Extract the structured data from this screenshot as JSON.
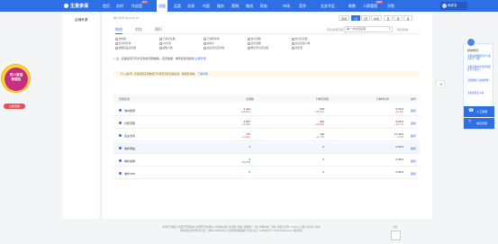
{
  "app": {
    "logo_text": "生意参谋",
    "user_label": "商家名"
  },
  "nav": {
    "items": [
      "首页",
      "实时",
      "作战室",
      "流量",
      "品类",
      "交易",
      "内容",
      "服务",
      "营销",
      "物流",
      "财务",
      "市场",
      "竞争",
      "业务专区",
      "取数",
      "人群管理",
      "学院"
    ],
    "active": "流量",
    "hot": {
      "作战室": "HOT",
      "人群管理": "NEW"
    }
  },
  "sidebar": {
    "items": [
      "店铺来源"
    ]
  },
  "main": {
    "update_time": "统计时间 2019-11-10",
    "range_buttons": [
      "实时",
      "1天",
      "7天",
      "30天",
      "日",
      "周",
      "月"
    ],
    "selected_range": "1天",
    "tabs": [
      "构成",
      "对比",
      "同行"
    ],
    "active_tab": "构成",
    "channel_label": "转化效果归属于：",
    "channel_select": "每一次访问来源",
    "hint_right": "所有终端",
    "checkboxes": [
      "访客数",
      "下单买家数",
      "下单转化率",
      "支付金额",
      "支付买家数",
      "支付转化率",
      "UV价值",
      "客单价",
      "新访客数",
      "关注店铺人数",
      "收藏商品买家数",
      "加购人数",
      "直接支付买家数",
      "粉丝支付买家数",
      "浏览量"
    ],
    "notice": {
      "text": "注：店铺来源已同步至新版流量看板，完善数据，推荐您使用新版",
      "link": "立即升级"
    },
    "warn": {
      "text": "【小二推荐】店铺流量来源数据已升级至完整链路追踪，数据更准确。",
      "link": "了解详情"
    },
    "table": {
      "headers": [
        "流量来源",
        "访客数",
        "下单买家数",
        "下单转化率",
        "操作"
      ],
      "rows": [
        {
          "name": "淘内免费",
          "v1": "3,422",
          "c1": "+125.56%",
          "c1dir": "up",
          "v2": "208",
          "c2": "+150.18%",
          "c2dir": "up",
          "v3": "6.07%",
          "c3": "+12.40%",
          "c3dir": "up",
          "op": "趋势"
        },
        {
          "name": "付费流量",
          "v1": "2,567",
          "c1": "+72.90%",
          "c1dir": "up",
          "v2": "200",
          "c2": "+132.88%",
          "c2dir": "up",
          "v3": "8.20%",
          "c3": "+69.71%",
          "c3dir": "up",
          "op": "趋势"
        },
        {
          "name": "自主访问",
          "v1": "775",
          "c1": "+14.00%",
          "c1dir": "up",
          "v2": "115",
          "c2": "+11.17%",
          "c2dir": "up",
          "v3": "17.42%",
          "c3": "-2.47%",
          "c3dir": "dn",
          "op": "趋势"
        },
        {
          "name": "淘外网站",
          "v1": "1",
          "c1": "-",
          "c1dir": "gray",
          "v2": "0",
          "c2": "-",
          "c2dir": "gray",
          "v3": "0.00%",
          "c3": "-",
          "c3dir": "gray",
          "op": "趋势"
        },
        {
          "name": "淘外媒体",
          "v1": "0",
          "c1": "-100.00%",
          "c1dir": "dn",
          "v2": "0",
          "c2": "-",
          "c2dir": "gray",
          "v3": "0.00%",
          "c3": "-",
          "c3dir": "gray",
          "op": "趋势"
        },
        {
          "name": "淘外APP",
          "v1": "0",
          "c1": "-",
          "c1dir": "gray",
          "v2": "0",
          "c2": "-",
          "c2dir": "gray",
          "v3": "0.00%",
          "c3": "-",
          "c3dir": "gray",
          "op": "趋势"
        }
      ]
    }
  },
  "promo": {
    "line1": "双11复盘",
    "line2": "数据包",
    "button": "立即查看"
  },
  "helper": {
    "title": "猜你想问：",
    "questions": [
      "流量来源数据为什么和实时不一致？",
      "流量来源中的免费流量是什么意思？",
      "流量数据下载在哪里？",
      "流量来源怎么看"
    ],
    "btn1": "人工客服",
    "btn2": "常见问题"
  },
  "footer": {
    "links": "阿里巴巴集团 | 阿里巴巴国际站 | 阿里巴巴中国站 | 全球速卖通 | 淘宝网 | 天猫 | 聚划算 | 一淘 | 阿里妈妈 | 飞猪 | 阿里云计算 | YunOS | 万网 | 支付宝 | 来往",
    "copyright": "增值电信业务经营许可证：浙B2-20080224-1  信息网络传播视听节目许可证：1109364号  © 2019 Taobao.com 版权所有",
    "qr_label": "手机"
  }
}
